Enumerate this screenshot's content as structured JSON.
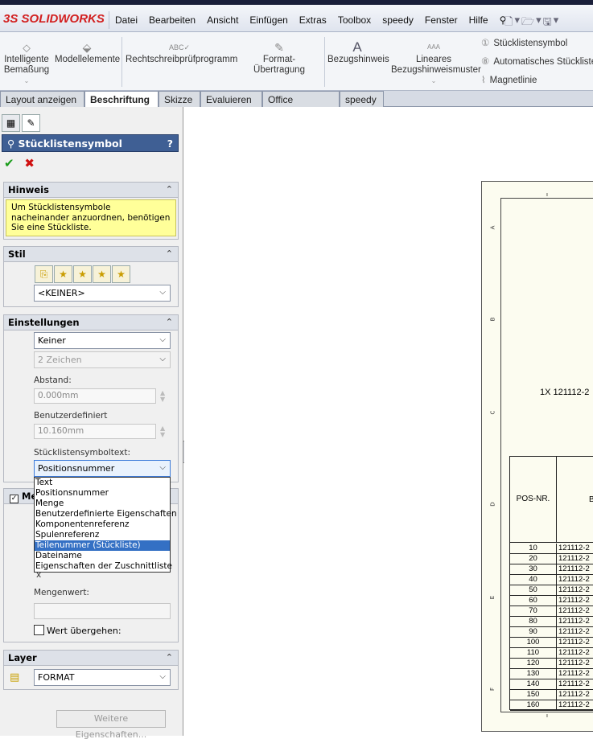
{
  "app": {
    "logo_text": "SOLIDWORKS",
    "logo_prefix": "3S"
  },
  "menu": [
    "Datei",
    "Bearbeiten",
    "Ansicht",
    "Einfügen",
    "Extras",
    "Toolbox",
    "speedy",
    "Fenster",
    "Hilfe"
  ],
  "ribbon": {
    "smart_dim": "Intelligente Bemaßung",
    "model_items": "Modellelemente",
    "spellcheck": "Rechtschreibprüfprogramm",
    "format_painter": "Format-Übertragung",
    "note": "Bezugshinweis",
    "linear_note": "Lineares Bezugshinweismuster",
    "balloon": "Stücklistensymbol",
    "auto_balloon": "Automatisches Stückliste",
    "magnetic_line": "Magnetlinie"
  },
  "tabs": [
    "Layout anzeigen",
    "Beschriftung",
    "Skizze",
    "Evaluieren",
    "Office Produkte",
    "speedy"
  ],
  "active_tab": "Beschriftung",
  "panel": {
    "title": "Stücklistensymbol",
    "help": "?",
    "hint": {
      "header": "Hinweis",
      "text": "Um Stücklistensymbole nacheinander anzuordnen, benötigen Sie eine Stückliste."
    },
    "style": {
      "header": "Stil",
      "value": "<KEINER>"
    },
    "settings": {
      "header": "Einstellungen",
      "style_value": "Keiner",
      "size_value": "2 Zeichen",
      "gap_label": "Abstand:",
      "gap_value": "0.000mm",
      "custom_label": "Benutzerdefiniert",
      "custom_value": "10.160mm",
      "text_label": "Stücklistensymboltext:",
      "text_value": "Positionsnummer"
    },
    "dropdown_options": [
      "Text",
      "Positionsnummer",
      "Menge",
      "Benutzerdefinierte Eigenschaften",
      "Komponentenreferenz",
      "Spulenreferenz",
      "Teilenummer (Stückliste)",
      "Dateiname",
      "Eigenschaften der Zuschnittliste"
    ],
    "dropdown_highlight": "Teilenummer (Stückliste)",
    "quantity": {
      "header": "Me",
      "checked": true,
      "value_label": "Mengenwert:",
      "override_label": "Wert übergehen:",
      "x_value": "x"
    },
    "layer": {
      "header": "Layer",
      "value": "FORMAT"
    },
    "more_button": "Weitere Eigenschaften..."
  },
  "drawing": {
    "view_label": "1X  121112-2",
    "bom_header": {
      "pos": "POS-NR.",
      "col2": "B"
    },
    "bom_rows": [
      {
        "pos": "10",
        "part": "121112-2"
      },
      {
        "pos": "20",
        "part": "121112-2"
      },
      {
        "pos": "30",
        "part": "121112-2"
      },
      {
        "pos": "40",
        "part": "121112-2"
      },
      {
        "pos": "50",
        "part": "121112-2"
      },
      {
        "pos": "60",
        "part": "121112-2"
      },
      {
        "pos": "70",
        "part": "121112-2"
      },
      {
        "pos": "80",
        "part": "121112-2"
      },
      {
        "pos": "90",
        "part": "121112-2"
      },
      {
        "pos": "100",
        "part": "121112-2"
      },
      {
        "pos": "110",
        "part": "121112-2"
      },
      {
        "pos": "120",
        "part": "121112-2"
      },
      {
        "pos": "130",
        "part": "121112-2"
      },
      {
        "pos": "140",
        "part": "121112-2"
      },
      {
        "pos": "150",
        "part": "121112-2"
      },
      {
        "pos": "160",
        "part": "121112-2"
      }
    ],
    "border_letters": [
      "A",
      "B",
      "C",
      "D",
      "E",
      "F"
    ]
  },
  "colors": {
    "panel_header": "#3f5f94",
    "hint_bg": "#ffff99",
    "highlight": "#3470c4",
    "logo": "#d21f1f"
  }
}
